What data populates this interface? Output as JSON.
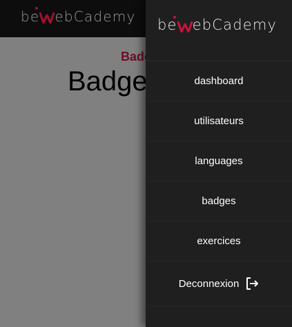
{
  "brand": {
    "prefix": "be",
    "suffix": "ebCademy",
    "accent_color": "#c8143c"
  },
  "page": {
    "kicker": "Badges",
    "title": "Badges"
  },
  "drawer": {
    "menu": [
      {
        "label": "dashboard"
      },
      {
        "label": "utilisateurs"
      },
      {
        "label": "languages"
      },
      {
        "label": "badges"
      },
      {
        "label": "exercices"
      }
    ],
    "logout": {
      "label": "Deconnexion",
      "icon": "logout-icon"
    }
  }
}
